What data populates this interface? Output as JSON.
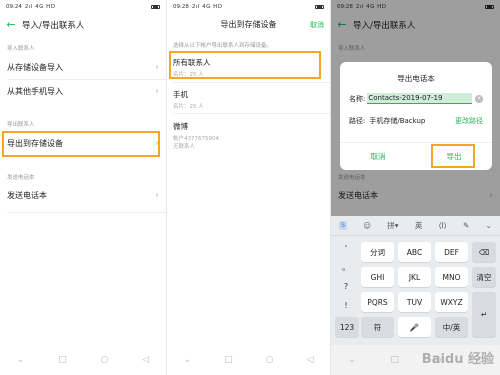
{
  "panel1": {
    "status": {
      "time": "09:24",
      "signal": "2ıl 4G HD"
    },
    "title": "导入/导出联系人",
    "section_import": "导入联系人",
    "items": [
      "从存储设备导入",
      "从其他手机导入"
    ],
    "section_export": "导出联系人",
    "export_item": "导出到存储设备",
    "section_send": "发送电话本",
    "send_item": "发送电话本"
  },
  "panel2": {
    "status": {
      "time": "09:28",
      "signal": "2ıl 4G HD"
    },
    "title": "导出到存储设备",
    "cancel": "取消",
    "hint": "选择从以下帐户导出联系人到存储设备。",
    "options": [
      {
        "title": "所有联系人",
        "sub": "名片：25 人"
      },
      {
        "title": "手机",
        "sub": "名片：25 人"
      },
      {
        "title": "微博",
        "sub": "帐户4377675904\n无联系人"
      }
    ]
  },
  "panel3": {
    "status": {
      "time": "09:28",
      "signal": "2ıl 4G HD"
    },
    "title": "导入/导出联系人",
    "section_import": "导入联系人",
    "send_item": "发送电话本",
    "section_send": "发送电话本",
    "dialog": {
      "title": "导出电话本",
      "name_label": "名称:",
      "name_value": "Contacts-2019-07-19",
      "path_label": "路径:",
      "path_value": "手机存储/Backup",
      "change_path": "更改路径",
      "cancel": "取消",
      "export": "导出"
    },
    "keyboard": {
      "top": [
        "S",
        "☺",
        "拼▾",
        "英",
        "⟨I⟩",
        "✎",
        "⌄"
      ],
      "row1": [
        "分词",
        "ABC",
        "DEF"
      ],
      "row2": [
        "GHI",
        "JKL",
        "MNO"
      ],
      "row3": [
        "PQRS",
        "TUV",
        "WXYZ"
      ],
      "side": [
        "'",
        "。",
        "?",
        "!"
      ],
      "bottom": [
        "123",
        "符",
        "中/英",
        "清空"
      ]
    },
    "watermark": "Baidu 经验"
  },
  "colors": {
    "accent": "#1db954",
    "highlight": "#f5a623"
  }
}
